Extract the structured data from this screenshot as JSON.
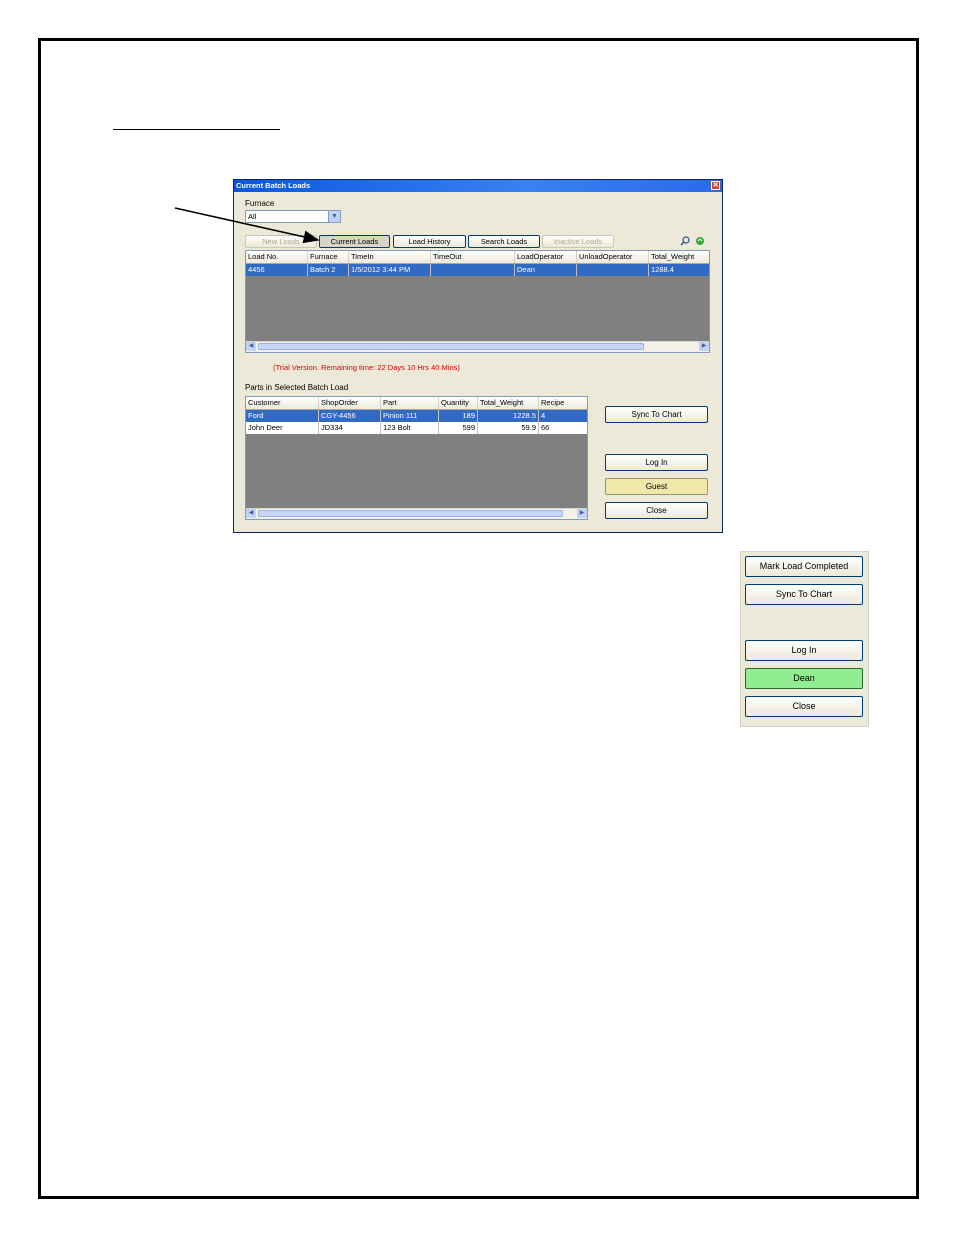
{
  "window": {
    "title": "Current Batch Loads",
    "close_glyph": "✕",
    "furnace_label": "Furnace",
    "furnace_value": "All",
    "tabs": [
      {
        "label": "New Loads",
        "state": "disabled"
      },
      {
        "label": "Current Loads",
        "state": "active"
      },
      {
        "label": "Load History",
        "state": "normal"
      },
      {
        "label": "Search Loads",
        "state": "normal"
      },
      {
        "label": "Inactive Loads",
        "state": "disabled"
      }
    ],
    "icons": {
      "search": "search-icon",
      "refresh": "refresh-icon"
    },
    "loads_table": {
      "columns": [
        "Load No.",
        "Furnace",
        "TimeIn",
        "TimeOut",
        "LoadOperator",
        "UnloadOperator",
        "Total_Weight"
      ],
      "rows": [
        {
          "load_no": "4456",
          "furnace": "Batch 2",
          "time_in": "1/5/2012 3:44 PM",
          "time_out": "",
          "load_operator": "Dean",
          "unload_operator": "",
          "total_weight": "1288.4"
        }
      ]
    },
    "trial_text": "(Trial Version. Remaining time: 22 Days 10 Hrs 40 Mins)",
    "parts_label": "Parts in Selected Batch Load",
    "parts_table": {
      "columns": [
        "Customer",
        "ShopOrder",
        "Part",
        "Quantity",
        "Total_Weight",
        "Recipe"
      ],
      "rows": [
        {
          "customer": "Ford",
          "shop_order": "CGY-4456",
          "part": "Pinion 111",
          "quantity": "189",
          "total_weight": "1228.5",
          "recipe": "4"
        },
        {
          "customer": "John Deer",
          "shop_order": "JD334",
          "part": "123 Bolt",
          "quantity": "599",
          "total_weight": "59.9",
          "recipe": "66"
        }
      ]
    },
    "buttons": {
      "sync": "Sync To Chart",
      "login": "Log In",
      "guest": "Guest",
      "close": "Close"
    }
  },
  "panel": {
    "buttons": {
      "mark": "Mark Load Completed",
      "sync": "Sync To Chart",
      "login": "Log In",
      "user": "Dean",
      "close": "Close"
    }
  },
  "colors": {
    "selection": "#316ac5",
    "trial_text": "#e00000",
    "guest": "#efe8a8",
    "user_green": "#90ee90"
  }
}
